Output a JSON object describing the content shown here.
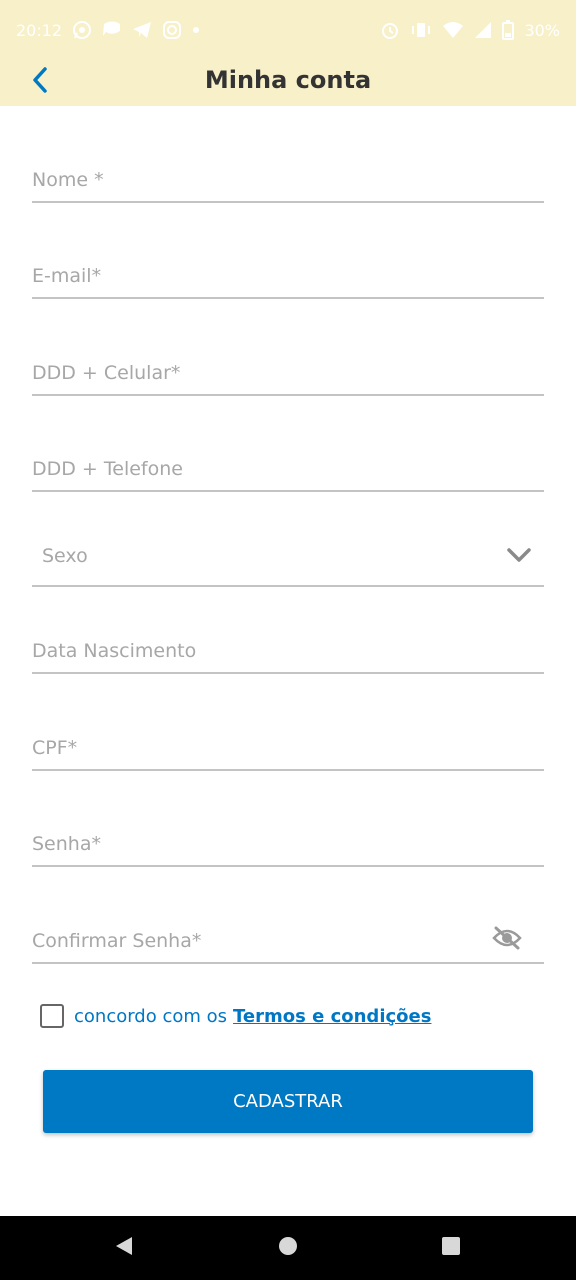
{
  "status_bar": {
    "time": "20:12",
    "battery": "30%",
    "left_icons": [
      "whatsapp-icon",
      "chat-icon",
      "telegram-icon",
      "instagram-icon",
      "dot-icon"
    ],
    "right_icons": [
      "alarm-icon",
      "vibrate-icon",
      "wifi-icon",
      "signal-icon",
      "battery-icon"
    ]
  },
  "header": {
    "title": "Minha conta",
    "back_icon": "chevron-left-icon"
  },
  "form": {
    "name_placeholder": "Nome *",
    "email_placeholder": "E-mail*",
    "mobile_placeholder": "DDD + Celular*",
    "phone_placeholder": "DDD + Telefone",
    "gender_label": "Sexo",
    "birthdate_placeholder": "Data Nascimento",
    "cpf_placeholder": "CPF*",
    "password_placeholder": "Senha*",
    "confirm_password_placeholder": "Confirmar Senha*"
  },
  "terms": {
    "text": "concordo com os",
    "link": "Termos e condições",
    "checked": false
  },
  "submit_label": "CADASTRAR",
  "colors": {
    "header_bg": "#f8f0c8",
    "accent": "#0079c4",
    "field_line": "#c4c4c4",
    "placeholder": "#a7a7a7"
  },
  "nav_bar": {
    "icons": [
      "back-triangle-icon",
      "home-circle-icon",
      "recents-square-icon"
    ]
  }
}
